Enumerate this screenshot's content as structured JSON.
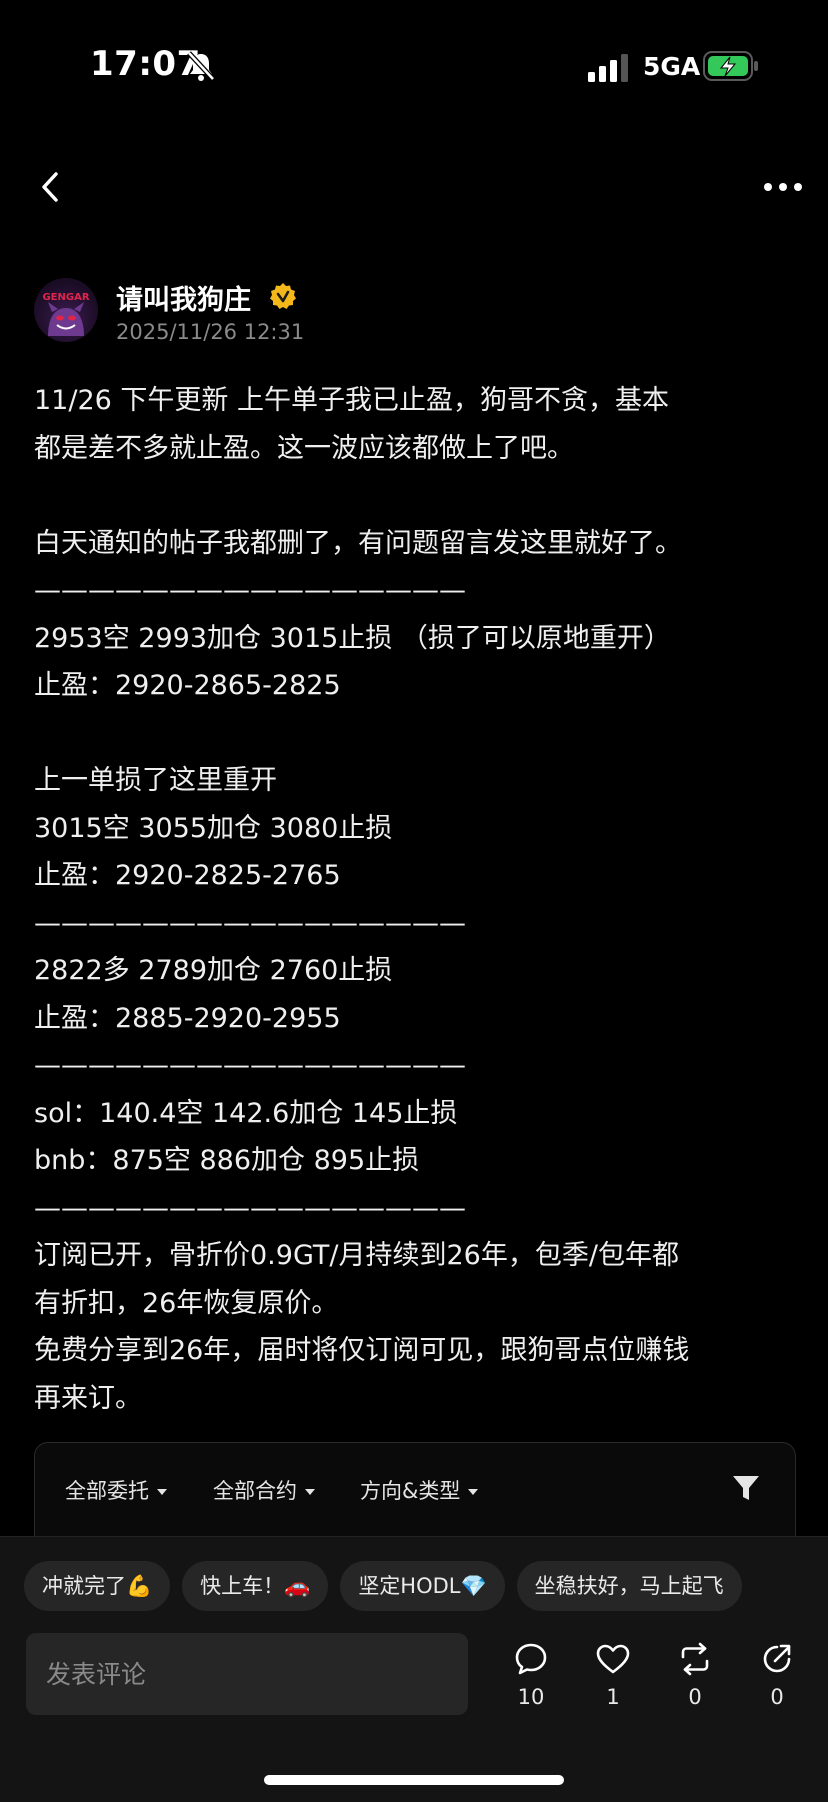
{
  "status_bar": {
    "time": "17:07",
    "network": "5GA"
  },
  "post": {
    "author": "请叫我狗庄",
    "date": "2025/11/26 12:31",
    "lines": [
      "11/26  下午更新  上午单子我已止盈，狗哥不贪，基本",
      "都是差不多就止盈。这一波应该都做上了吧。",
      "",
      "白天通知的帖子我都删了，有问题留言发这里就好了。",
      "————————————————",
      "2953空 2993加仓 3015止损 （损了可以原地重开）",
      "止盈：2920-2865-2825",
      "",
      "上一单损了这里重开",
      "3015空 3055加仓 3080止损",
      "止盈：2920-2825-2765",
      "————————————————",
      "2822多 2789加仓 2760止损",
      "止盈：2885-2920-2955",
      "————————————————",
      "sol：140.4空 142.6加仓 145止损",
      "bnb：875空 886加仓 895止损",
      "————————————————",
      "订阅已开，骨折价0.9GT/月持续到26年，包季/包年都",
      "有折扣，26年恢复原价。",
      "免费分享到26年，届时将仅订阅可见，跟狗哥点位赚钱",
      "再来订。"
    ]
  },
  "order_card": {
    "filters": [
      "全部委托",
      "全部合约",
      "方向&类型"
    ]
  },
  "quick_replies": [
    "冲就完了💪",
    "快上车！🚗",
    "坚定HODL💎",
    "坐稳扶好，马上起飞"
  ],
  "comment": {
    "placeholder": "发表评论"
  },
  "actions": {
    "comments": "10",
    "likes": "1",
    "reposts": "0",
    "shares": "0"
  }
}
